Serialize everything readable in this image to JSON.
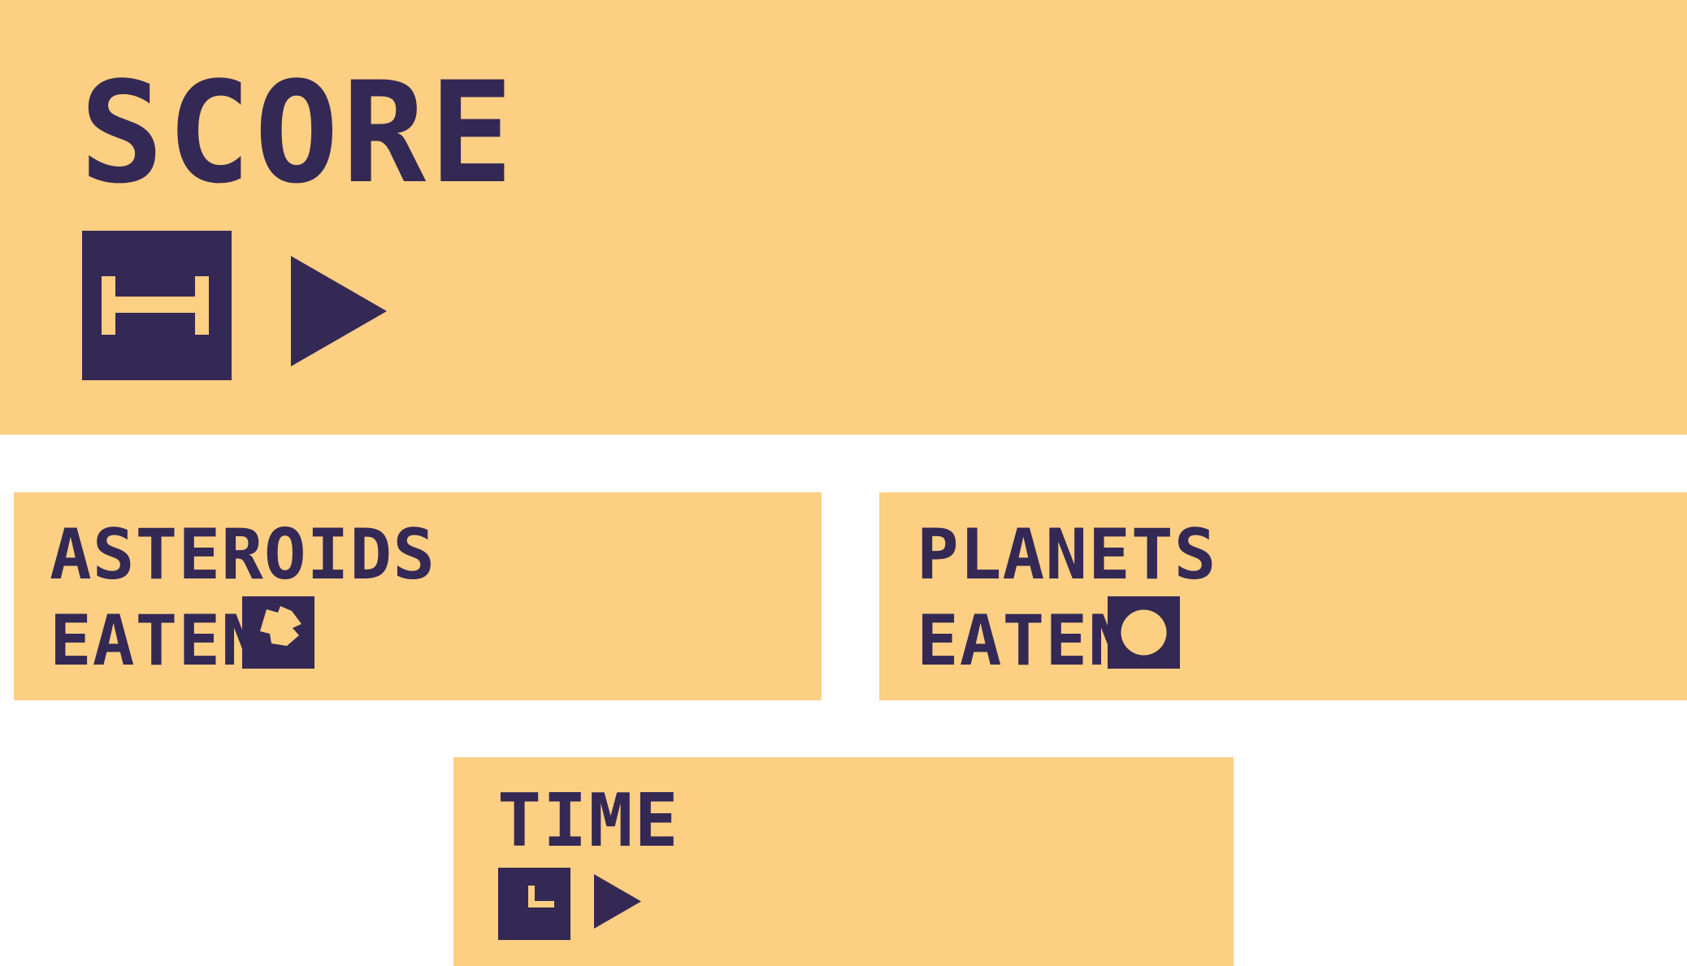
{
  "colors": {
    "panel": "#FDCF83",
    "ink": "#342954",
    "background": "#FFFFFF"
  },
  "score": {
    "title": "SCORE",
    "icon": "h-key-icon",
    "action_icon": "play-icon"
  },
  "asteroids": {
    "line1": "ASTEROIDS",
    "line2": "EATEN",
    "icon": "asteroid-icon"
  },
  "planets": {
    "line1": "PLANETS",
    "line2": "EATEN",
    "icon": "planet-icon"
  },
  "time": {
    "title": "TIME",
    "icon": "clock-icon",
    "action_icon": "play-icon"
  }
}
